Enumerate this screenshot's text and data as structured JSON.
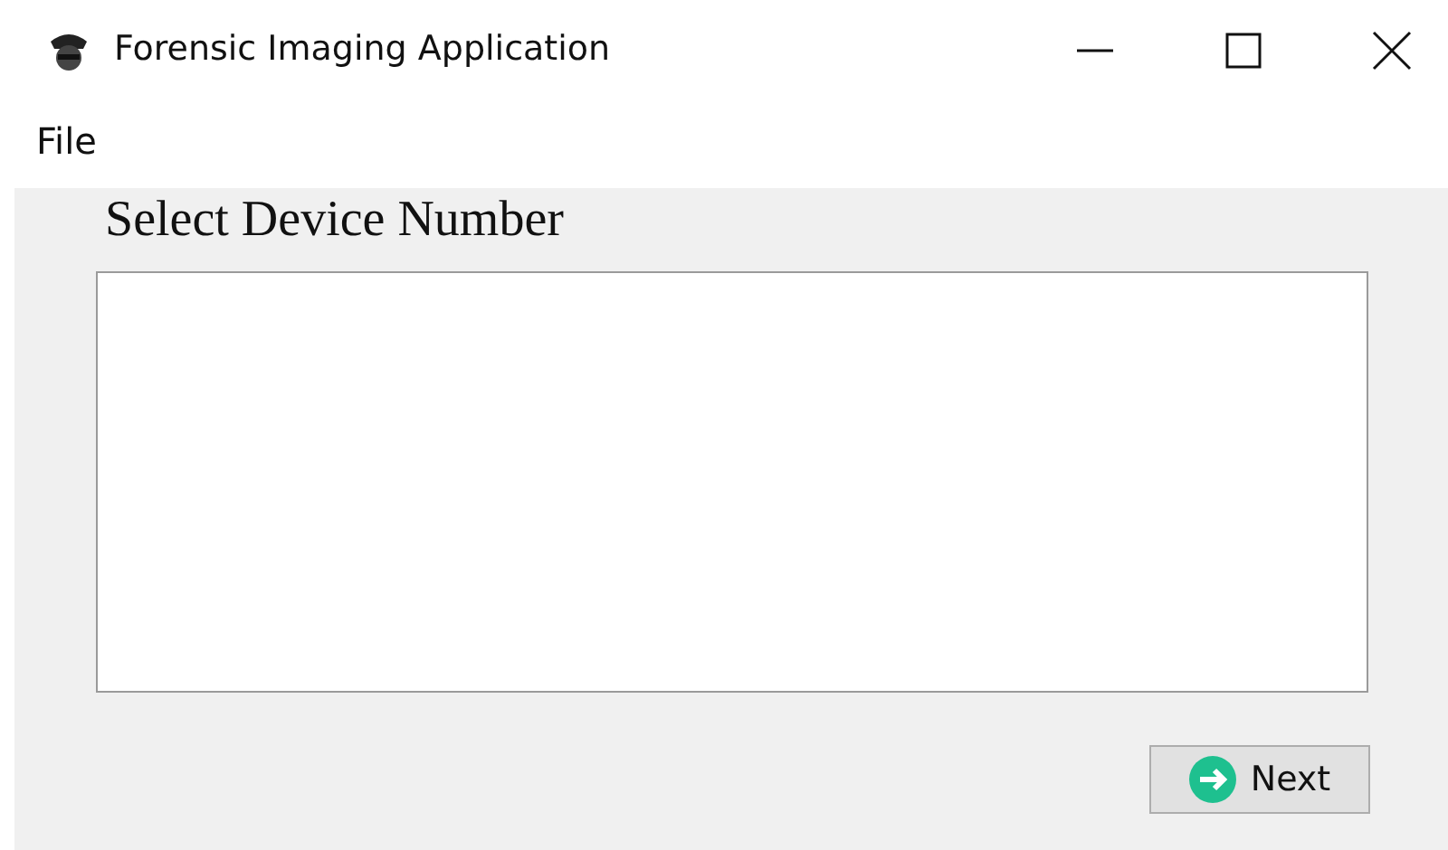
{
  "window": {
    "title": "Forensic Imaging Application"
  },
  "menu": [
    "File"
  ],
  "heading": "Select Device Number",
  "next_button": {
    "label": "Next"
  }
}
